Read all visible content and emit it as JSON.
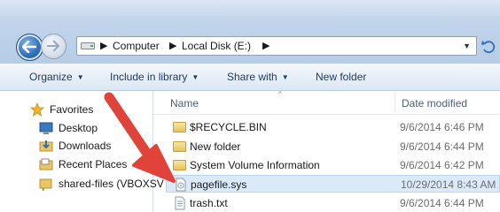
{
  "address_bar": {
    "crumbs": [
      "Computer",
      "Local Disk (E:)"
    ]
  },
  "toolbar": {
    "organize_label": "Organize",
    "include_label": "Include in library",
    "share_label": "Share with",
    "new_folder_label": "New folder"
  },
  "navigation": {
    "favorites_label": "Favorites",
    "items": [
      {
        "label": "Desktop",
        "icon": "desktop-icon"
      },
      {
        "label": "Downloads",
        "icon": "downloads-icon"
      },
      {
        "label": "Recent Places",
        "icon": "recent-places-icon"
      }
    ],
    "shared_label": "shared-files (VBOXSV"
  },
  "columns": {
    "name": "Name",
    "date_modified": "Date modified"
  },
  "files": [
    {
      "name": "$RECYCLE.BIN",
      "date": "9/6/2014 6:46 PM",
      "type": "folder"
    },
    {
      "name": "New folder",
      "date": "9/6/2014 6:44 PM",
      "type": "folder"
    },
    {
      "name": "System Volume Information",
      "date": "9/6/2014 6:42 PM",
      "type": "folder"
    },
    {
      "name": "pagefile.sys",
      "date": "10/29/2014 8:43 AM",
      "type": "system-file",
      "selected": true
    },
    {
      "name": "trash.txt",
      "date": "9/6/2014 6:44 PM",
      "type": "text-file"
    }
  ],
  "colors": {
    "selection": "#dbeaf9",
    "annotation_arrow": "#e0433a"
  }
}
